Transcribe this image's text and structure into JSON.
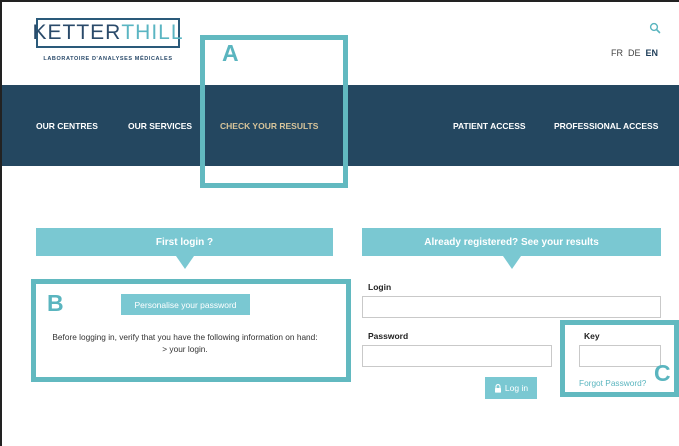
{
  "header": {
    "logo_part1": "KETTER",
    "logo_part2": "THILL",
    "tagline": "LABORATOIRE D'ANALYSES MÉDICALES",
    "languages": [
      "FR",
      "DE",
      "EN"
    ],
    "active_language": "EN"
  },
  "nav": {
    "items": [
      {
        "label": "OUR CENTRES"
      },
      {
        "label": "OUR SERVICES"
      },
      {
        "label": "CHECK YOUR RESULTS"
      },
      {
        "label": "PATIENT ACCESS"
      },
      {
        "label": "PROFESSIONAL ACCESS"
      }
    ]
  },
  "annotations": {
    "a": "A",
    "b": "B",
    "c": "C"
  },
  "first_login": {
    "title": "First login ?",
    "button_label": "Personalise your password",
    "info_line1": "Before logging in, verify that you have the following information on hand:",
    "info_line2": "> your login."
  },
  "registered": {
    "title": "Already registered? See your results",
    "login_label": "Login",
    "password_label": "Password",
    "key_label": "Key",
    "login_button": "Log in",
    "forgot_link": "Forgot Password?"
  },
  "colors": {
    "nav_bg": "#244760",
    "accent": "#7ac8d2",
    "annotation": "#62b9c0",
    "nav_highlight": "#d7c49a"
  }
}
